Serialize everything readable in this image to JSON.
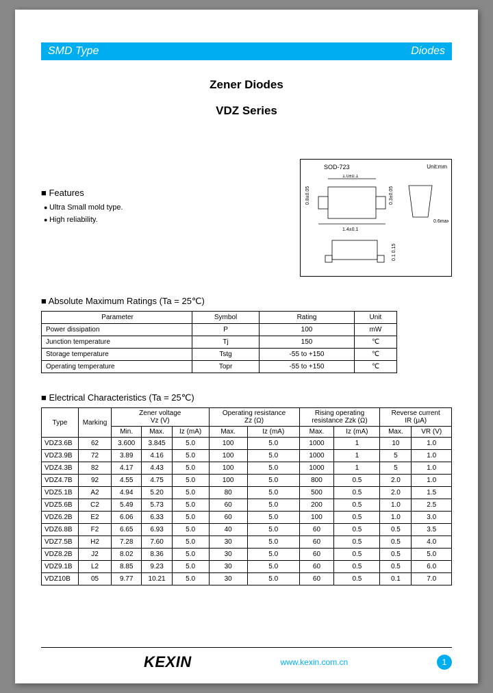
{
  "header": {
    "left": "SMD Type",
    "right": "Diodes"
  },
  "title": {
    "line1": "Zener Diodes",
    "line2": "VDZ Series"
  },
  "features": {
    "heading": "Features",
    "items": [
      "Ultra Small mold type.",
      "High reliability."
    ]
  },
  "package": {
    "label": "SOD-723",
    "unit": "Unit:mm"
  },
  "abs": {
    "heading": "Absolute Maximum Ratings (Ta = 25℃)",
    "headers": [
      "Parameter",
      "Symbol",
      "Rating",
      "Unit"
    ],
    "rows": [
      [
        "Power dissipation",
        "P",
        "100",
        "mW"
      ],
      [
        "Junction temperature",
        "Tj",
        "150",
        "℃"
      ],
      [
        "Storage temperature",
        "Tstg",
        "-55 to +150",
        "℃"
      ],
      [
        "Operating temperature",
        "Topr",
        "-55 to +150",
        "℃"
      ]
    ]
  },
  "ec": {
    "heading": "Electrical Characteristics (Ta = 25℃)",
    "group_headers": [
      "Type",
      "Marking",
      "Zener voltage\nVz (V)",
      "Operating resistance\nZz (Ω)",
      "Rising operating\nresistance  Zzk (Ω)",
      "Reverse current\nIR (μA)"
    ],
    "sub_headers": [
      "Min.",
      "Max.",
      "Iz (mA)",
      "Max.",
      "Iz (mA)",
      "Max.",
      "Iz (mA)",
      "Max.",
      "VR (V)"
    ],
    "rows": [
      [
        "VDZ3.6B",
        "62",
        "3.600",
        "3.845",
        "5.0",
        "100",
        "5.0",
        "1000",
        "1",
        "10",
        "1.0"
      ],
      [
        "VDZ3.9B",
        "72",
        "3.89",
        "4.16",
        "5.0",
        "100",
        "5.0",
        "1000",
        "1",
        "5",
        "1.0"
      ],
      [
        "VDZ4.3B",
        "82",
        "4.17",
        "4.43",
        "5.0",
        "100",
        "5.0",
        "1000",
        "1",
        "5",
        "1.0"
      ],
      [
        "VDZ4.7B",
        "92",
        "4.55",
        "4.75",
        "5.0",
        "100",
        "5.0",
        "800",
        "0.5",
        "2.0",
        "1.0"
      ],
      [
        "VDZ5.1B",
        "A2",
        "4.94",
        "5.20",
        "5.0",
        "80",
        "5.0",
        "500",
        "0.5",
        "2.0",
        "1.5"
      ],
      [
        "VDZ5.6B",
        "C2",
        "5.49",
        "5.73",
        "5.0",
        "60",
        "5.0",
        "200",
        "0.5",
        "1.0",
        "2.5"
      ],
      [
        "VDZ6.2B",
        "E2",
        "6.06",
        "6.33",
        "5.0",
        "60",
        "5.0",
        "100",
        "0.5",
        "1.0",
        "3.0"
      ],
      [
        "VDZ6.8B",
        "F2",
        "6.65",
        "6.93",
        "5.0",
        "40",
        "5.0",
        "60",
        "0.5",
        "0.5",
        "3.5"
      ],
      [
        "VDZ7.5B",
        "H2",
        "7.28",
        "7.60",
        "5.0",
        "30",
        "5.0",
        "60",
        "0.5",
        "0.5",
        "4.0"
      ],
      [
        "VDZ8.2B",
        "J2",
        "8.02",
        "8.36",
        "5.0",
        "30",
        "5.0",
        "60",
        "0.5",
        "0.5",
        "5.0"
      ],
      [
        "VDZ9.1B",
        "L2",
        "8.85",
        "9.23",
        "5.0",
        "30",
        "5.0",
        "60",
        "0.5",
        "0.5",
        "6.0"
      ],
      [
        "VDZ10B",
        "05",
        "9.77",
        "10.21",
        "5.0",
        "30",
        "5.0",
        "60",
        "0.5",
        "0.1",
        "7.0"
      ]
    ]
  },
  "footer": {
    "logo": "KEXIN",
    "url": "www.kexin.com.cn",
    "page": "1"
  },
  "chart_data": {
    "type": "table",
    "title": "VDZ Series Zener Diodes — Electrical Characteristics (Ta=25℃)",
    "columns": [
      "Type",
      "Marking",
      "Vz Min (V)",
      "Vz Max (V)",
      "Iz (mA)",
      "Zz Max (Ω)",
      "Zz Iz (mA)",
      "Zzk Max (Ω)",
      "Zzk Iz (mA)",
      "IR Max (μA)",
      "VR (V)"
    ],
    "rows": [
      [
        "VDZ3.6B",
        "62",
        3.6,
        3.845,
        5.0,
        100,
        5.0,
        1000,
        1,
        10,
        1.0
      ],
      [
        "VDZ3.9B",
        "72",
        3.89,
        4.16,
        5.0,
        100,
        5.0,
        1000,
        1,
        5,
        1.0
      ],
      [
        "VDZ4.3B",
        "82",
        4.17,
        4.43,
        5.0,
        100,
        5.0,
        1000,
        1,
        5,
        1.0
      ],
      [
        "VDZ4.7B",
        "92",
        4.55,
        4.75,
        5.0,
        100,
        5.0,
        800,
        0.5,
        2.0,
        1.0
      ],
      [
        "VDZ5.1B",
        "A2",
        4.94,
        5.2,
        5.0,
        80,
        5.0,
        500,
        0.5,
        2.0,
        1.5
      ],
      [
        "VDZ5.6B",
        "C2",
        5.49,
        5.73,
        5.0,
        60,
        5.0,
        200,
        0.5,
        1.0,
        2.5
      ],
      [
        "VDZ6.2B",
        "E2",
        6.06,
        6.33,
        5.0,
        60,
        5.0,
        100,
        0.5,
        1.0,
        3.0
      ],
      [
        "VDZ6.8B",
        "F2",
        6.65,
        6.93,
        5.0,
        40,
        5.0,
        60,
        0.5,
        0.5,
        3.5
      ],
      [
        "VDZ7.5B",
        "H2",
        7.28,
        7.6,
        5.0,
        30,
        5.0,
        60,
        0.5,
        0.5,
        4.0
      ],
      [
        "VDZ8.2B",
        "J2",
        8.02,
        8.36,
        5.0,
        30,
        5.0,
        60,
        0.5,
        0.5,
        5.0
      ],
      [
        "VDZ9.1B",
        "L2",
        8.85,
        9.23,
        5.0,
        30,
        5.0,
        60,
        0.5,
        0.5,
        6.0
      ],
      [
        "VDZ10B",
        "05",
        9.77,
        10.21,
        5.0,
        30,
        5.0,
        60,
        0.5,
        0.1,
        7.0
      ]
    ]
  }
}
